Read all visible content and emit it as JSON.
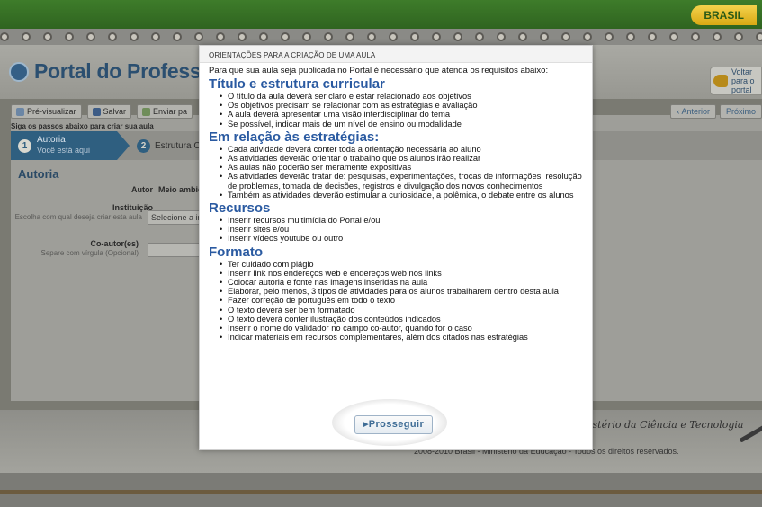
{
  "background": {
    "brand": "BRASIL",
    "portal_title": "Portal do Professor",
    "back_button": "Voltar para o portal",
    "toolbar": {
      "preview": "Pré-visualizar",
      "save": "Salvar",
      "send": "Enviar pa",
      "steps_hint": "Siga os passos abaixo para criar sua aula"
    },
    "nav": {
      "previous": "‹ Anterior",
      "next": "Próximo"
    },
    "steps": [
      {
        "num": "1",
        "label": "Autoria",
        "sublabel": "Você está aqui"
      },
      {
        "num": "2",
        "label": "Estrutura Curr"
      }
    ],
    "section_title": "Autoria",
    "form": {
      "author_label": "Autor",
      "author_value": "Meio ambient",
      "institution_label": "Instituição",
      "institution_hint": "Escolha com qual deseja criar esta aula",
      "institution_value": "Selecione a in",
      "coauthor_label": "Co-autor(es)",
      "coauthor_hint": "Separe com vírgula (Opcional)"
    },
    "footer": {
      "ministry": "istério da Ciência e Tecnologia",
      "copyright": "2008-2010 Brasil - Ministério da Educação - Todos os direitos reservados."
    }
  },
  "modal": {
    "header": "ORIENTAÇÕES PARA A CRIAÇÃO DE UMA AULA",
    "intro": "Para que sua aula seja publicada no Portal é necessário que atenda os requisitos abaixo:",
    "sections": [
      {
        "title": "Título e estrutura curricular",
        "items": [
          "O título da aula deverá ser claro e estar relacionado aos objetivos",
          "Os objetivos precisam se relacionar com as estratégias e avaliação",
          "A aula deverá apresentar uma visão interdisciplinar do tema",
          "Se possível, indicar mais de um nível de ensino ou modalidade"
        ]
      },
      {
        "title": "Em relação às estratégias:",
        "items": [
          "Cada atividade deverá conter toda a orientação necessária ao aluno",
          "As atividades deverão orientar o trabalho que os alunos irão realizar",
          "As aulas não poderão ser meramente expositivas",
          "As atividades deverão tratar de: pesquisas, experimentações, trocas de informações, resolução de problemas, tomada de decisões, registros e divulgação dos novos conhecimentos",
          "Também as atividades deverão estimular a curiosidade, a polêmica, o debate entre os alunos"
        ]
      },
      {
        "title": "Recursos",
        "items": [
          "Inserir recursos multimídia do Portal e/ou",
          "Inserir sites e/ou",
          "Inserir vídeos youtube ou outro"
        ]
      },
      {
        "title": "Formato",
        "items": [
          "Ter cuidado com plágio",
          "Inserir link nos endereços web e endereços web nos links",
          "Colocar autoria e fonte nas imagens inseridas na aula",
          "Elaborar, pelo menos, 3 tipos de atividades para os alunos trabalharem dentro desta aula",
          "Fazer correção de português em todo o texto",
          "O texto deverá ser bem formatado",
          "O texto deverá conter ilustração dos conteúdos indicados",
          "Inserir o nome do validador no campo co-autor, quando for o caso",
          "Indicar materiais em recursos complementares, além dos citados nas estratégias"
        ]
      }
    ],
    "continue_button": "▸Prosseguir"
  }
}
